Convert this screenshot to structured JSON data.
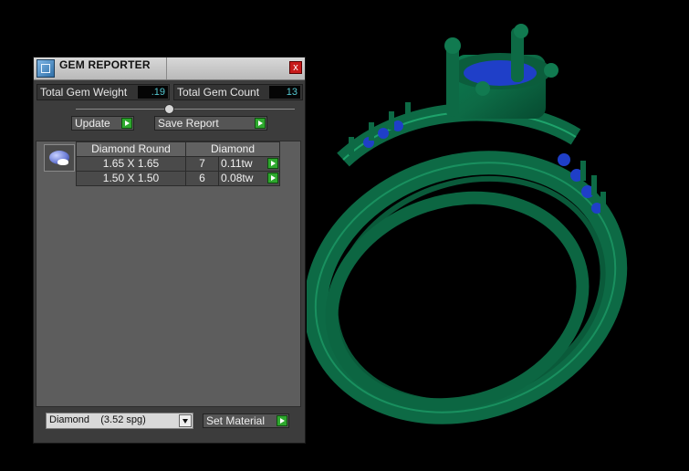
{
  "window": {
    "title": "GEM REPORTER",
    "close_label": "x"
  },
  "stats": {
    "total_weight_label": "Total Gem Weight",
    "total_weight_value": ".19",
    "total_count_label": "Total Gem Count",
    "total_count_value": "13"
  },
  "buttons": {
    "update": "Update",
    "save_report": "Save Report",
    "set_material": "Set Material"
  },
  "gem_list": {
    "header_shape": "Diamond Round",
    "header_material": "Diamond",
    "rows": [
      {
        "size": "1.65 X 1.65",
        "count": "7",
        "weight": "0.11tw"
      },
      {
        "size": "1.50 X 1.50",
        "count": "6",
        "weight": "0.08tw"
      }
    ]
  },
  "material": {
    "selected": "Diamond    (3.52 spg)"
  },
  "icons": [
    "app-icon",
    "close-icon",
    "gem-thumbnail-icon",
    "go-arrow-icon",
    "dropdown-arrow-icon"
  ],
  "colors": {
    "ring_metal": "#0d6a45",
    "gem": "#1f3fc8",
    "background": "#000000"
  }
}
